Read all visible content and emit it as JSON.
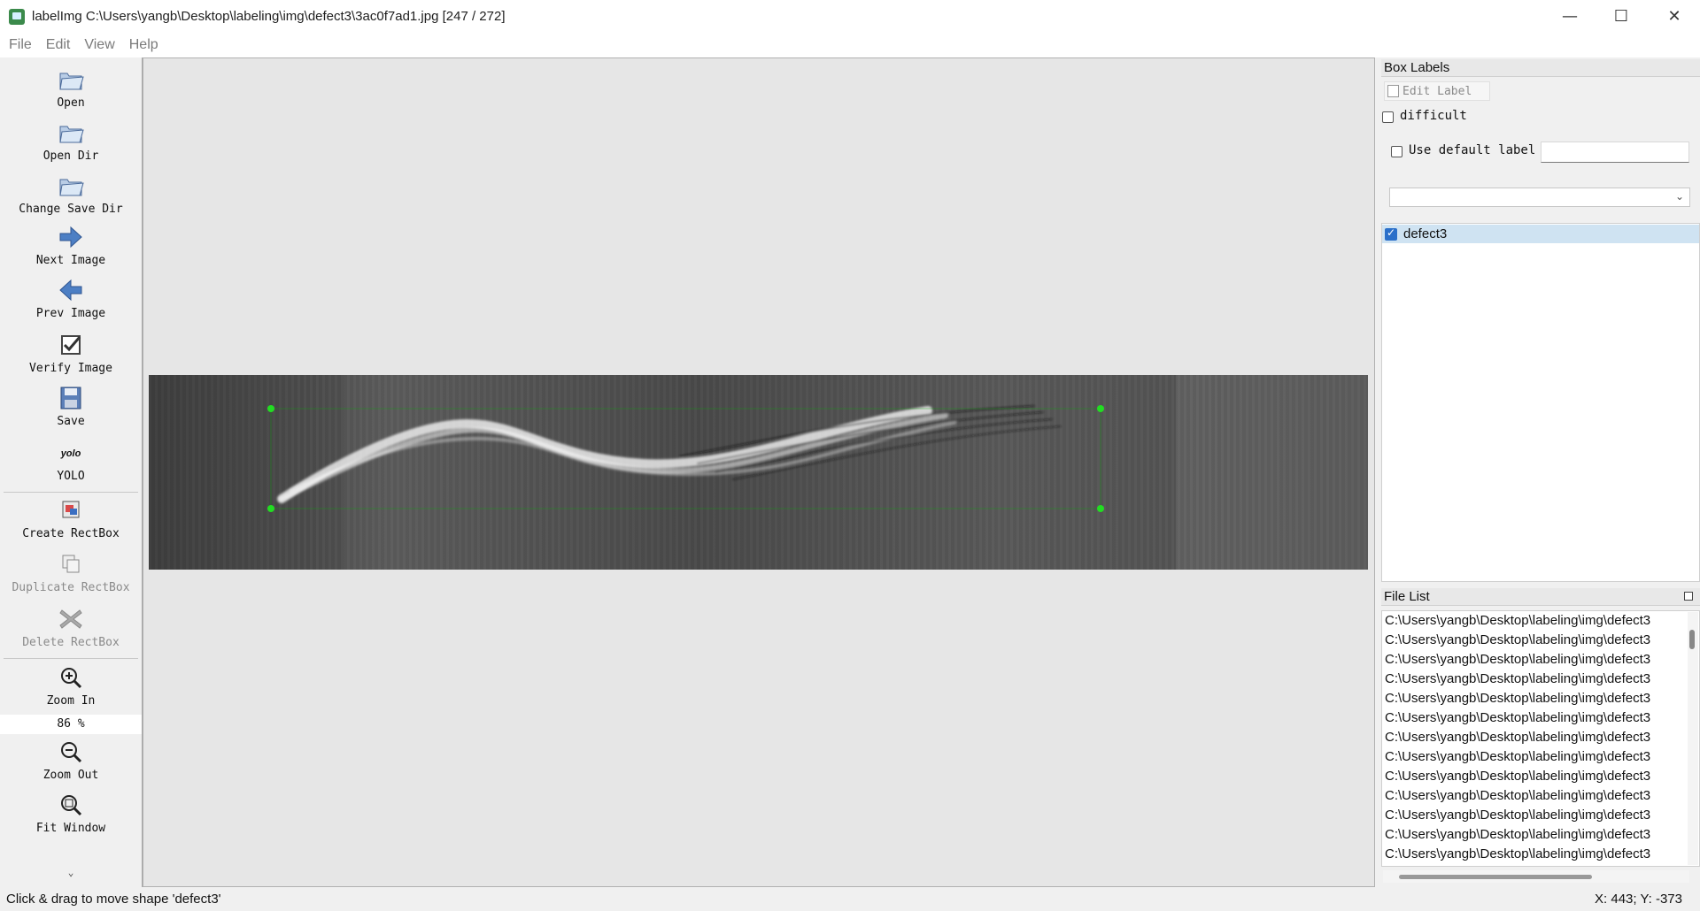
{
  "window": {
    "title": "labelImg C:\\Users\\yangb\\Desktop\\labeling\\img\\defect3\\3ac0f7ad1.jpg [247 / 272]",
    "controls": [
      "—",
      "☐",
      "✕"
    ]
  },
  "menu": [
    "File",
    "Edit",
    "View",
    "Help"
  ],
  "toolbar": {
    "open": "Open",
    "open_dir": "Open Dir",
    "change_save_dir": "Change Save Dir",
    "next_image": "Next Image",
    "prev_image": "Prev Image",
    "verify_image": "Verify Image",
    "save": "Save",
    "yolo_icon_text": "yolo",
    "yolo": "YOLO",
    "create_rectbox": "Create RectBox",
    "duplicate_rectbox": "Duplicate RectBox",
    "delete_rectbox": "Delete RectBox",
    "zoom_in": "Zoom In",
    "zoom_value": "86 %",
    "zoom_out": "Zoom Out",
    "fit_window": "Fit Window",
    "more": "⌄"
  },
  "box_labels": {
    "header": "Box Labels",
    "edit_label": "Edit Label",
    "difficult": "difficult",
    "use_default_label": "Use default label",
    "default_label_value": "",
    "labels": [
      {
        "name": "defect3",
        "checked": true
      }
    ]
  },
  "file_list": {
    "header": "File List",
    "items": [
      "C:\\Users\\yangb\\Desktop\\labeling\\img\\defect3",
      "C:\\Users\\yangb\\Desktop\\labeling\\img\\defect3",
      "C:\\Users\\yangb\\Desktop\\labeling\\img\\defect3",
      "C:\\Users\\yangb\\Desktop\\labeling\\img\\defect3",
      "C:\\Users\\yangb\\Desktop\\labeling\\img\\defect3",
      "C:\\Users\\yangb\\Desktop\\labeling\\img\\defect3",
      "C:\\Users\\yangb\\Desktop\\labeling\\img\\defect3",
      "C:\\Users\\yangb\\Desktop\\labeling\\img\\defect3",
      "C:\\Users\\yangb\\Desktop\\labeling\\img\\defect3",
      "C:\\Users\\yangb\\Desktop\\labeling\\img\\defect3",
      "C:\\Users\\yangb\\Desktop\\labeling\\img\\defect3",
      "C:\\Users\\yangb\\Desktop\\labeling\\img\\defect3",
      "C:\\Users\\yangb\\Desktop\\labeling\\img\\defect3"
    ]
  },
  "status": {
    "message": "Click & drag to move shape 'defect3'",
    "coords": "X: 443; Y: -373"
  },
  "colors": {
    "handle": "#22dd22",
    "selection": "#cfe3f2",
    "checkbox": "#2a6fc9"
  }
}
